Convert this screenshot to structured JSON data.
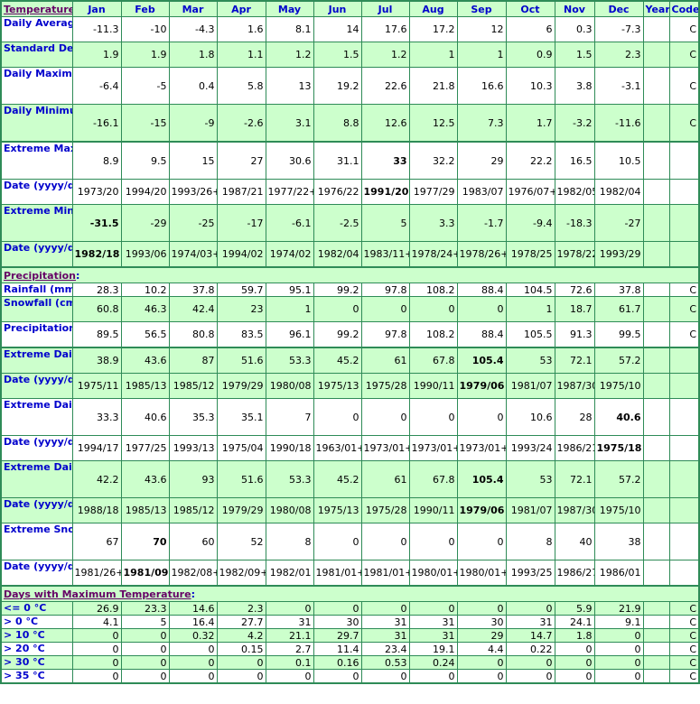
{
  "header": {
    "section_label": "Temperature",
    "months": [
      "Jan",
      "Feb",
      "Mar",
      "Apr",
      "May",
      "Jun",
      "Jul",
      "Aug",
      "Sep",
      "Oct",
      "Nov",
      "Dec"
    ],
    "year_label": "Year",
    "code_label": "Code"
  },
  "colors": {
    "header_bg": "#ccffcc",
    "label_text": "#0000cc",
    "section_link": "#660066",
    "border": "#2e8b57"
  },
  "temperature": [
    {
      "label": "Daily Average (°C)",
      "values": [
        "-11.3",
        "-10",
        "-4.3",
        "1.6",
        "8.1",
        "14",
        "17.6",
        "17.2",
        "12",
        "6",
        "0.3",
        "-7.3"
      ],
      "year": "",
      "code": "C",
      "bold": []
    },
    {
      "label": "Standard Deviation",
      "values": [
        "1.9",
        "1.9",
        "1.8",
        "1.1",
        "1.2",
        "1.5",
        "1.2",
        "1",
        "1",
        "0.9",
        "1.5",
        "2.3"
      ],
      "year": "",
      "code": "C",
      "bold": []
    },
    {
      "label": "Daily Maximum (°C)",
      "values": [
        "-6.4",
        "-5",
        "0.4",
        "5.8",
        "13",
        "19.2",
        "22.6",
        "21.8",
        "16.6",
        "10.3",
        "3.8",
        "-3.1"
      ],
      "year": "",
      "code": "C",
      "bold": []
    },
    {
      "label": "Daily Minimum (°C)",
      "values": [
        "-16.1",
        "-15",
        "-9",
        "-2.6",
        "3.1",
        "8.8",
        "12.6",
        "12.5",
        "7.3",
        "1.7",
        "-3.2",
        "-11.6"
      ],
      "year": "",
      "code": "C",
      "bold": []
    },
    {
      "label": "Extreme Maximum (°C)",
      "values": [
        "8.9",
        "9.5",
        "15",
        "27",
        "30.6",
        "31.1",
        "33",
        "32.2",
        "29",
        "22.2",
        "16.5",
        "10.5"
      ],
      "year": "",
      "code": "",
      "bold": [
        6
      ]
    },
    {
      "label": "Date (yyyy/dd)",
      "values": [
        "1973/20",
        "1994/20",
        "1993/26+",
        "1987/21",
        "1977/22+",
        "1976/22",
        "1991/20",
        "1977/29",
        "1983/07",
        "1976/07+",
        "1982/05",
        "1982/04"
      ],
      "year": "",
      "code": "",
      "bold": [
        6
      ]
    },
    {
      "label": "Extreme Minimum (°C)",
      "values": [
        "-31.5",
        "-29",
        "-25",
        "-17",
        "-6.1",
        "-2.5",
        "5",
        "3.3",
        "-1.7",
        "-9.4",
        "-18.3",
        "-27"
      ],
      "year": "",
      "code": "",
      "bold": [
        0
      ]
    },
    {
      "label": "Date (yyyy/dd)",
      "values": [
        "1982/18",
        "1993/06",
        "1974/03+",
        "1994/02",
        "1974/02",
        "1982/04",
        "1983/11+",
        "1978/24+",
        "1978/26+",
        "1978/25",
        "1978/22",
        "1993/29"
      ],
      "year": "",
      "code": "",
      "bold": [
        0
      ]
    }
  ],
  "precipitation_section_label": "Precipitation",
  "precipitation": [
    {
      "label": "Rainfall (mm)",
      "values": [
        "28.3",
        "10.2",
        "37.8",
        "59.7",
        "95.1",
        "99.2",
        "97.8",
        "108.2",
        "88.4",
        "104.5",
        "72.6",
        "37.8"
      ],
      "year": "",
      "code": "C",
      "bold": []
    },
    {
      "label": "Snowfall (cm)",
      "values": [
        "60.8",
        "46.3",
        "42.4",
        "23",
        "1",
        "0",
        "0",
        "0",
        "0",
        "1",
        "18.7",
        "61.7"
      ],
      "year": "",
      "code": "C",
      "bold": []
    },
    {
      "label": "Precipitation (mm)",
      "values": [
        "89.5",
        "56.5",
        "80.8",
        "83.5",
        "96.1",
        "99.2",
        "97.8",
        "108.2",
        "88.4",
        "105.5",
        "91.3",
        "99.5"
      ],
      "year": "",
      "code": "C",
      "bold": []
    },
    {
      "label": "Extreme Daily Rainfall (mm)",
      "values": [
        "38.9",
        "43.6",
        "87",
        "51.6",
        "53.3",
        "45.2",
        "61",
        "67.8",
        "105.4",
        "53",
        "72.1",
        "57.2"
      ],
      "year": "",
      "code": "",
      "bold": [
        8
      ]
    },
    {
      "label": "Date (yyyy/dd)",
      "values": [
        "1975/11",
        "1985/13",
        "1985/12",
        "1979/29",
        "1980/08",
        "1975/13",
        "1975/28",
        "1990/11",
        "1979/06",
        "1981/07",
        "1987/30",
        "1975/10"
      ],
      "year": "",
      "code": "",
      "bold": [
        8
      ]
    },
    {
      "label": "Extreme Daily Snowfall (cm)",
      "values": [
        "33.3",
        "40.6",
        "35.3",
        "35.1",
        "7",
        "0",
        "0",
        "0",
        "0",
        "10.6",
        "28",
        "40.6"
      ],
      "year": "",
      "code": "",
      "bold": [
        11
      ]
    },
    {
      "label": "Date (yyyy/dd)",
      "values": [
        "1994/17",
        "1977/25",
        "1993/13",
        "1975/04",
        "1990/18",
        "1963/01+",
        "1973/01+",
        "1973/01+",
        "1973/01+",
        "1993/24",
        "1986/21",
        "1975/18"
      ],
      "year": "",
      "code": "",
      "bold": [
        11
      ]
    },
    {
      "label": "Extreme Daily Precipitation (mm)",
      "values": [
        "42.2",
        "43.6",
        "93",
        "51.6",
        "53.3",
        "45.2",
        "61",
        "67.8",
        "105.4",
        "53",
        "72.1",
        "57.2"
      ],
      "year": "",
      "code": "",
      "bold": [
        8
      ]
    },
    {
      "label": "Date (yyyy/dd)",
      "values": [
        "1988/18",
        "1985/13",
        "1985/12",
        "1979/29",
        "1980/08",
        "1975/13",
        "1975/28",
        "1990/11",
        "1979/06",
        "1981/07",
        "1987/30",
        "1975/10"
      ],
      "year": "",
      "code": "",
      "bold": [
        8
      ]
    },
    {
      "label": "Extreme Snow Depth (cm)",
      "values": [
        "67",
        "70",
        "60",
        "52",
        "8",
        "0",
        "0",
        "0",
        "0",
        "8",
        "40",
        "38"
      ],
      "year": "",
      "code": "",
      "bold": [
        1
      ]
    },
    {
      "label": "Date (yyyy/dd)",
      "values": [
        "1981/26+",
        "1981/09",
        "1982/08+",
        "1982/09+",
        "1982/01",
        "1981/01+",
        "1981/01+",
        "1980/01+",
        "1980/01+",
        "1993/25",
        "1986/27",
        "1986/01"
      ],
      "year": "",
      "code": "",
      "bold": [
        1
      ]
    }
  ],
  "days_section_label": "Days with Maximum Temperature",
  "days": [
    {
      "label": "<= 0 °C",
      "values": [
        "26.9",
        "23.3",
        "14.6",
        "2.3",
        "0",
        "0",
        "0",
        "0",
        "0",
        "0",
        "5.9",
        "21.9"
      ],
      "year": "",
      "code": "C",
      "bold": []
    },
    {
      "label": "> 0 °C",
      "values": [
        "4.1",
        "5",
        "16.4",
        "27.7",
        "31",
        "30",
        "31",
        "31",
        "30",
        "31",
        "24.1",
        "9.1"
      ],
      "year": "",
      "code": "C",
      "bold": []
    },
    {
      "label": "> 10 °C",
      "values": [
        "0",
        "0",
        "0.32",
        "4.2",
        "21.1",
        "29.7",
        "31",
        "31",
        "29",
        "14.7",
        "1.8",
        "0"
      ],
      "year": "",
      "code": "C",
      "bold": []
    },
    {
      "label": "> 20 °C",
      "values": [
        "0",
        "0",
        "0",
        "0.15",
        "2.7",
        "11.4",
        "23.4",
        "19.1",
        "4.4",
        "0.22",
        "0",
        "0"
      ],
      "year": "",
      "code": "C",
      "bold": []
    },
    {
      "label": "> 30 °C",
      "values": [
        "0",
        "0",
        "0",
        "0",
        "0.1",
        "0.16",
        "0.53",
        "0.24",
        "0",
        "0",
        "0",
        "0"
      ],
      "year": "",
      "code": "C",
      "bold": []
    },
    {
      "label": "> 35 °C",
      "values": [
        "0",
        "0",
        "0",
        "0",
        "0",
        "0",
        "0",
        "0",
        "0",
        "0",
        "0",
        "0"
      ],
      "year": "",
      "code": "C",
      "bold": []
    }
  ]
}
